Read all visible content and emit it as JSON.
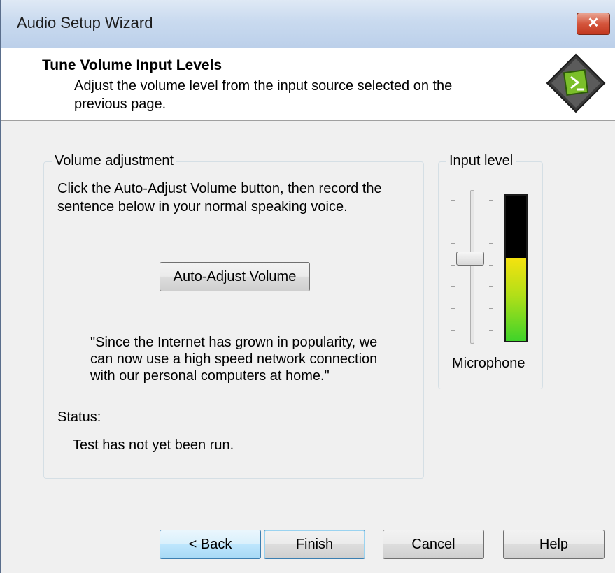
{
  "window": {
    "title": "Audio Setup Wizard",
    "close_glyph": "✕"
  },
  "header": {
    "title": "Tune Volume Input Levels",
    "description": "Adjust the volume level from the input source selected on the previous page.",
    "logo_icon": "wizard-logo-icon"
  },
  "volume_group": {
    "legend": "Volume adjustment",
    "instructions": "Click the Auto-Adjust Volume button, then record the sentence below in your normal speaking voice.",
    "auto_adjust_label": "Auto-Adjust Volume",
    "sentence": "\"Since the Internet has grown in popularity, we can now use a high speed network connection with our personal computers at home.\"",
    "status_label": "Status:",
    "status_value": "Test has not yet been run."
  },
  "input_group": {
    "legend": "Input level",
    "device_label": "Microphone",
    "slider_level": 0.55,
    "meter_level": 0.57
  },
  "buttons": {
    "back": "< Back",
    "finish": "Finish",
    "cancel": "Cancel",
    "help": "Help"
  },
  "colors": {
    "meter_top": "#f5e20f",
    "meter_bottom": "#3fd32a",
    "close_button": "#c2381f",
    "focus_border": "#3c7fb1"
  }
}
